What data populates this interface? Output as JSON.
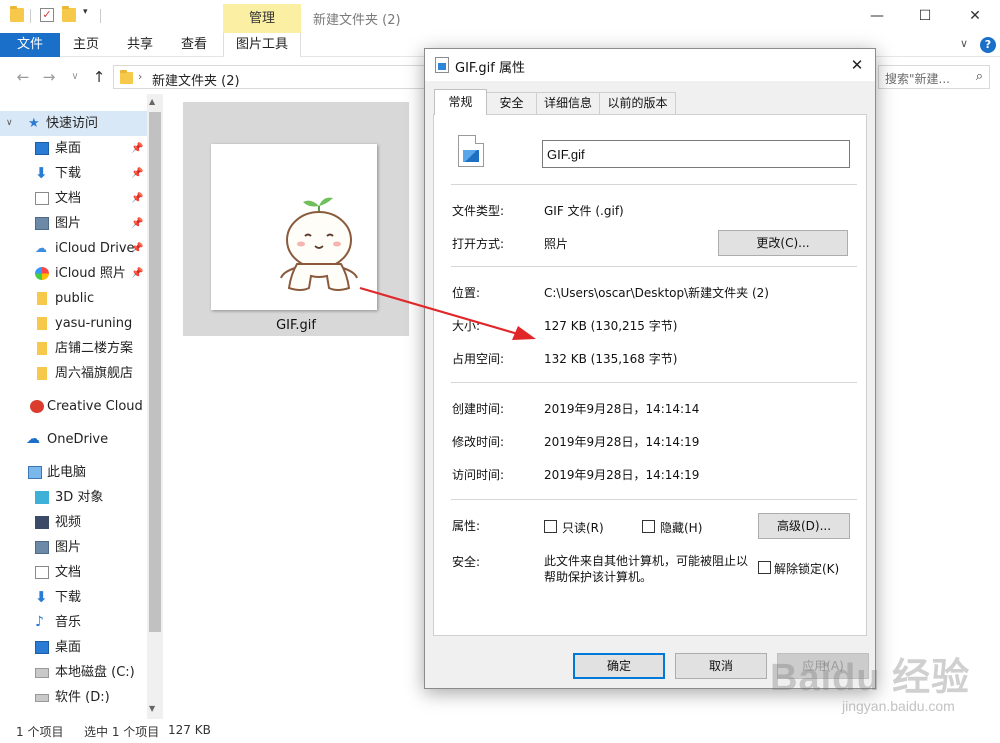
{
  "explorer": {
    "title": "新建文件夹 (2)",
    "context_tab": "管理",
    "ribbon_tabs": [
      "文件",
      "主页",
      "共享",
      "查看",
      "图片工具"
    ],
    "address": "新建文件夹 (2)",
    "search_placeholder": "搜索\"新建...",
    "nav_items": [
      {
        "label": "快速访问"
      },
      {
        "label": "桌面"
      },
      {
        "label": "下载"
      },
      {
        "label": "文档"
      },
      {
        "label": "图片"
      },
      {
        "label": "iCloud Drive"
      },
      {
        "label": "iCloud 照片"
      },
      {
        "label": "public"
      },
      {
        "label": "yasu-runing"
      },
      {
        "label": "店铺二楼方案"
      },
      {
        "label": "周六福旗舰店"
      },
      {
        "label": "Creative Cloud F"
      },
      {
        "label": "OneDrive"
      },
      {
        "label": "此电脑"
      },
      {
        "label": "3D 对象"
      },
      {
        "label": "视频"
      },
      {
        "label": "图片"
      },
      {
        "label": "文档"
      },
      {
        "label": "下载"
      },
      {
        "label": "音乐"
      },
      {
        "label": "桌面"
      },
      {
        "label": "本地磁盘 (C:)"
      },
      {
        "label": "软件 (D:)"
      }
    ],
    "file_name": "GIF.gif",
    "status": {
      "count": "1 个项目",
      "selected": "选中 1 个项目",
      "size": "127 KB"
    }
  },
  "dialog": {
    "title": "GIF.gif 属性",
    "tabs": [
      "常规",
      "安全",
      "详细信息",
      "以前的版本"
    ],
    "name_value": "GIF.gif",
    "rows": {
      "type_label": "文件类型:",
      "type_value": "GIF 文件 (.gif)",
      "open_label": "打开方式:",
      "open_value": "照片",
      "change_button": "更改(C)...",
      "location_label": "位置:",
      "location_value": "C:\\Users\\oscar\\Desktop\\新建文件夹 (2)",
      "size_label": "大小:",
      "size_value": "127 KB (130,215 字节)",
      "disk_label": "占用空间:",
      "disk_value": "132 KB (135,168 字节)",
      "created_label": "创建时间:",
      "created_value": "2019年9月28日，14:14:14",
      "modified_label": "修改时间:",
      "modified_value": "2019年9月28日，14:14:19",
      "accessed_label": "访问时间:",
      "accessed_value": "2019年9月28日，14:14:19",
      "attr_label": "属性:",
      "readonly_label": "只读(R)",
      "hidden_label": "隐藏(H)",
      "advanced_button": "高级(D)...",
      "security_label": "安全:",
      "security_text": "此文件来自其他计算机，可能被阻止以帮助保护该计算机。",
      "unblock_label": "解除锁定(K)"
    },
    "buttons": {
      "ok": "确定",
      "cancel": "取消",
      "apply": "应用(A)"
    }
  },
  "watermark": {
    "text": "Baidu 经验",
    "sub": "jingyan.baidu.com"
  },
  "colors": {
    "accent": "#1a6fc9",
    "arrow": "#e0282b",
    "context_tab": "#fbefa4"
  }
}
